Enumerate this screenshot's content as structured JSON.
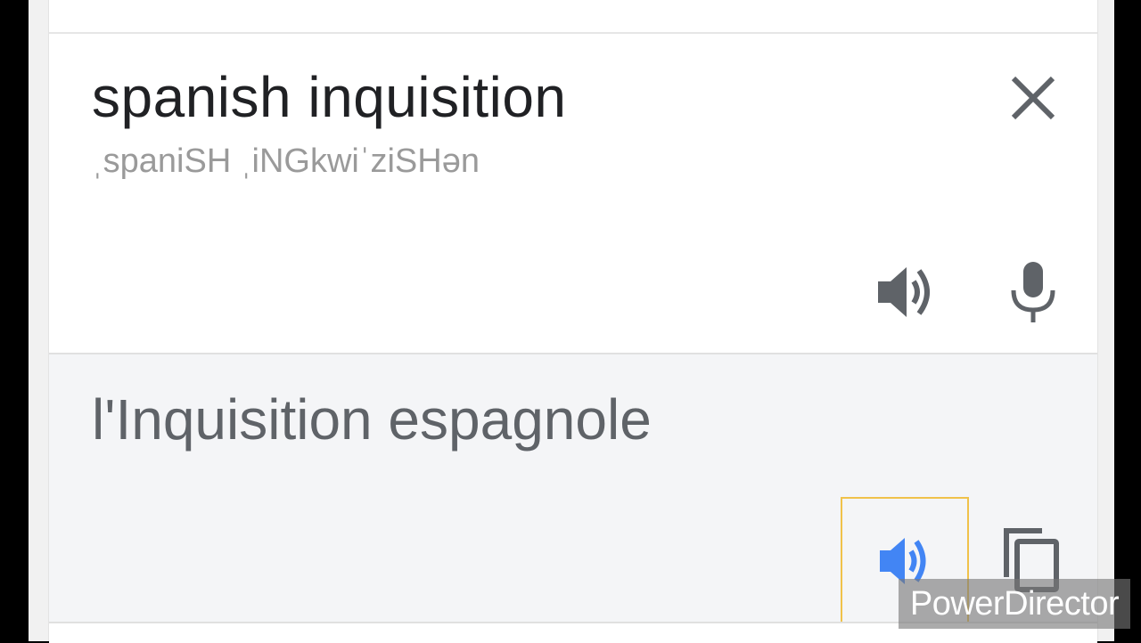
{
  "source": {
    "text": "spanish inquisition",
    "phonetic": "ˌspaniSH ˌiNGkwiˈziSHən"
  },
  "result": {
    "text": "l'Inquisition espagnole"
  },
  "icons": {
    "clear": "close-icon",
    "source_speak": "speaker-icon",
    "voice_input": "microphone-icon",
    "result_speak": "speaker-icon",
    "copy": "copy-icon"
  },
  "colors": {
    "text_primary": "#202124",
    "text_secondary": "#5f6368",
    "phonetic": "#9a9a9a",
    "active_icon": "#4285f4",
    "focus_outline": "#f0c24a",
    "result_background": "#f4f5f7"
  },
  "watermark": {
    "text": "PowerDirector"
  }
}
